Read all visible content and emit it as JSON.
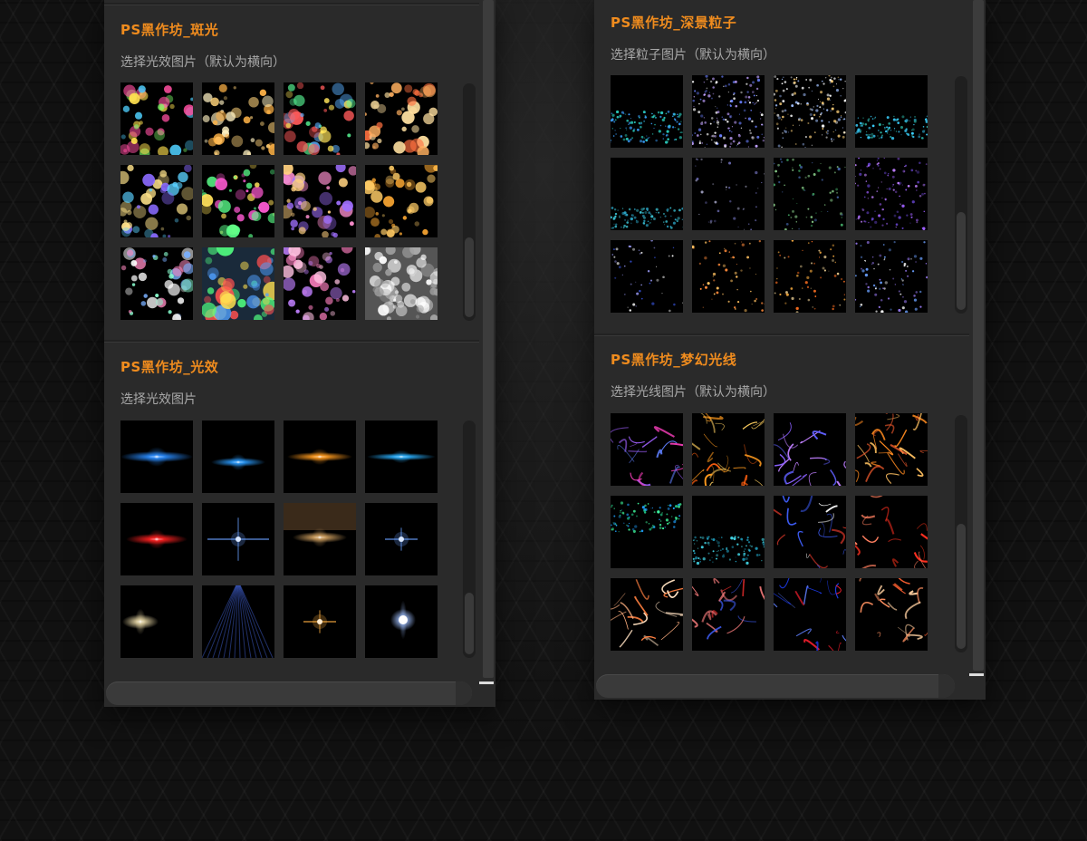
{
  "left_panel": {
    "sections": [
      {
        "title": "PS黑作坊_斑光",
        "desc": "选择光效图片（默认为横向）",
        "thumbs": [
          "butterflies-bokeh",
          "hearts-bokeh",
          "colorful-bokeh",
          "sparkle-bokeh",
          "heart-bokeh-blue",
          "star-bokeh-green",
          "flower-bokeh-purple",
          "heart-bokeh-gold",
          "glitter-bokeh",
          "traffic-bokeh",
          "pink-bokeh",
          "silver-bokeh"
        ]
      },
      {
        "title": "PS黑作坊_光效",
        "desc": "选择光效图片",
        "thumbs": [
          "blue-flare",
          "blue-burst",
          "orange-flare",
          "cyan-flare",
          "red-flare",
          "blue-star",
          "golden-spot",
          "blue-twinkle",
          "white-glow",
          "blue-rays",
          "gold-star",
          "white-orb"
        ]
      }
    ]
  },
  "right_panel": {
    "sections": [
      {
        "title": "PS黑作坊_深景粒子",
        "desc": "选择粒子图片（默认为横向）",
        "thumbs": [
          "teal-particles",
          "blue-particles",
          "gold-particles",
          "cyan-wave",
          "teal-wave",
          "dark-particles",
          "green-particles",
          "purple-particles",
          "dark-dots",
          "orange-dots",
          "amber-dots",
          "blue-dots"
        ]
      },
      {
        "title": "PS黑作坊_梦幻光线",
        "desc": "选择光线图片（默认为横向）",
        "thumbs": [
          "purple-streaks",
          "fire-sparks",
          "violet-streaks",
          "gold-streaks",
          "green-drips",
          "teal-drips",
          "light-trails",
          "red-swirl",
          "orange-strands",
          "red-blue-trails",
          "blue-red-glitch",
          "copper-trails"
        ]
      }
    ]
  },
  "colors": {
    "title": "#f08c1e",
    "desc": "#a8a8a8",
    "panel": "#2a2a2a"
  }
}
